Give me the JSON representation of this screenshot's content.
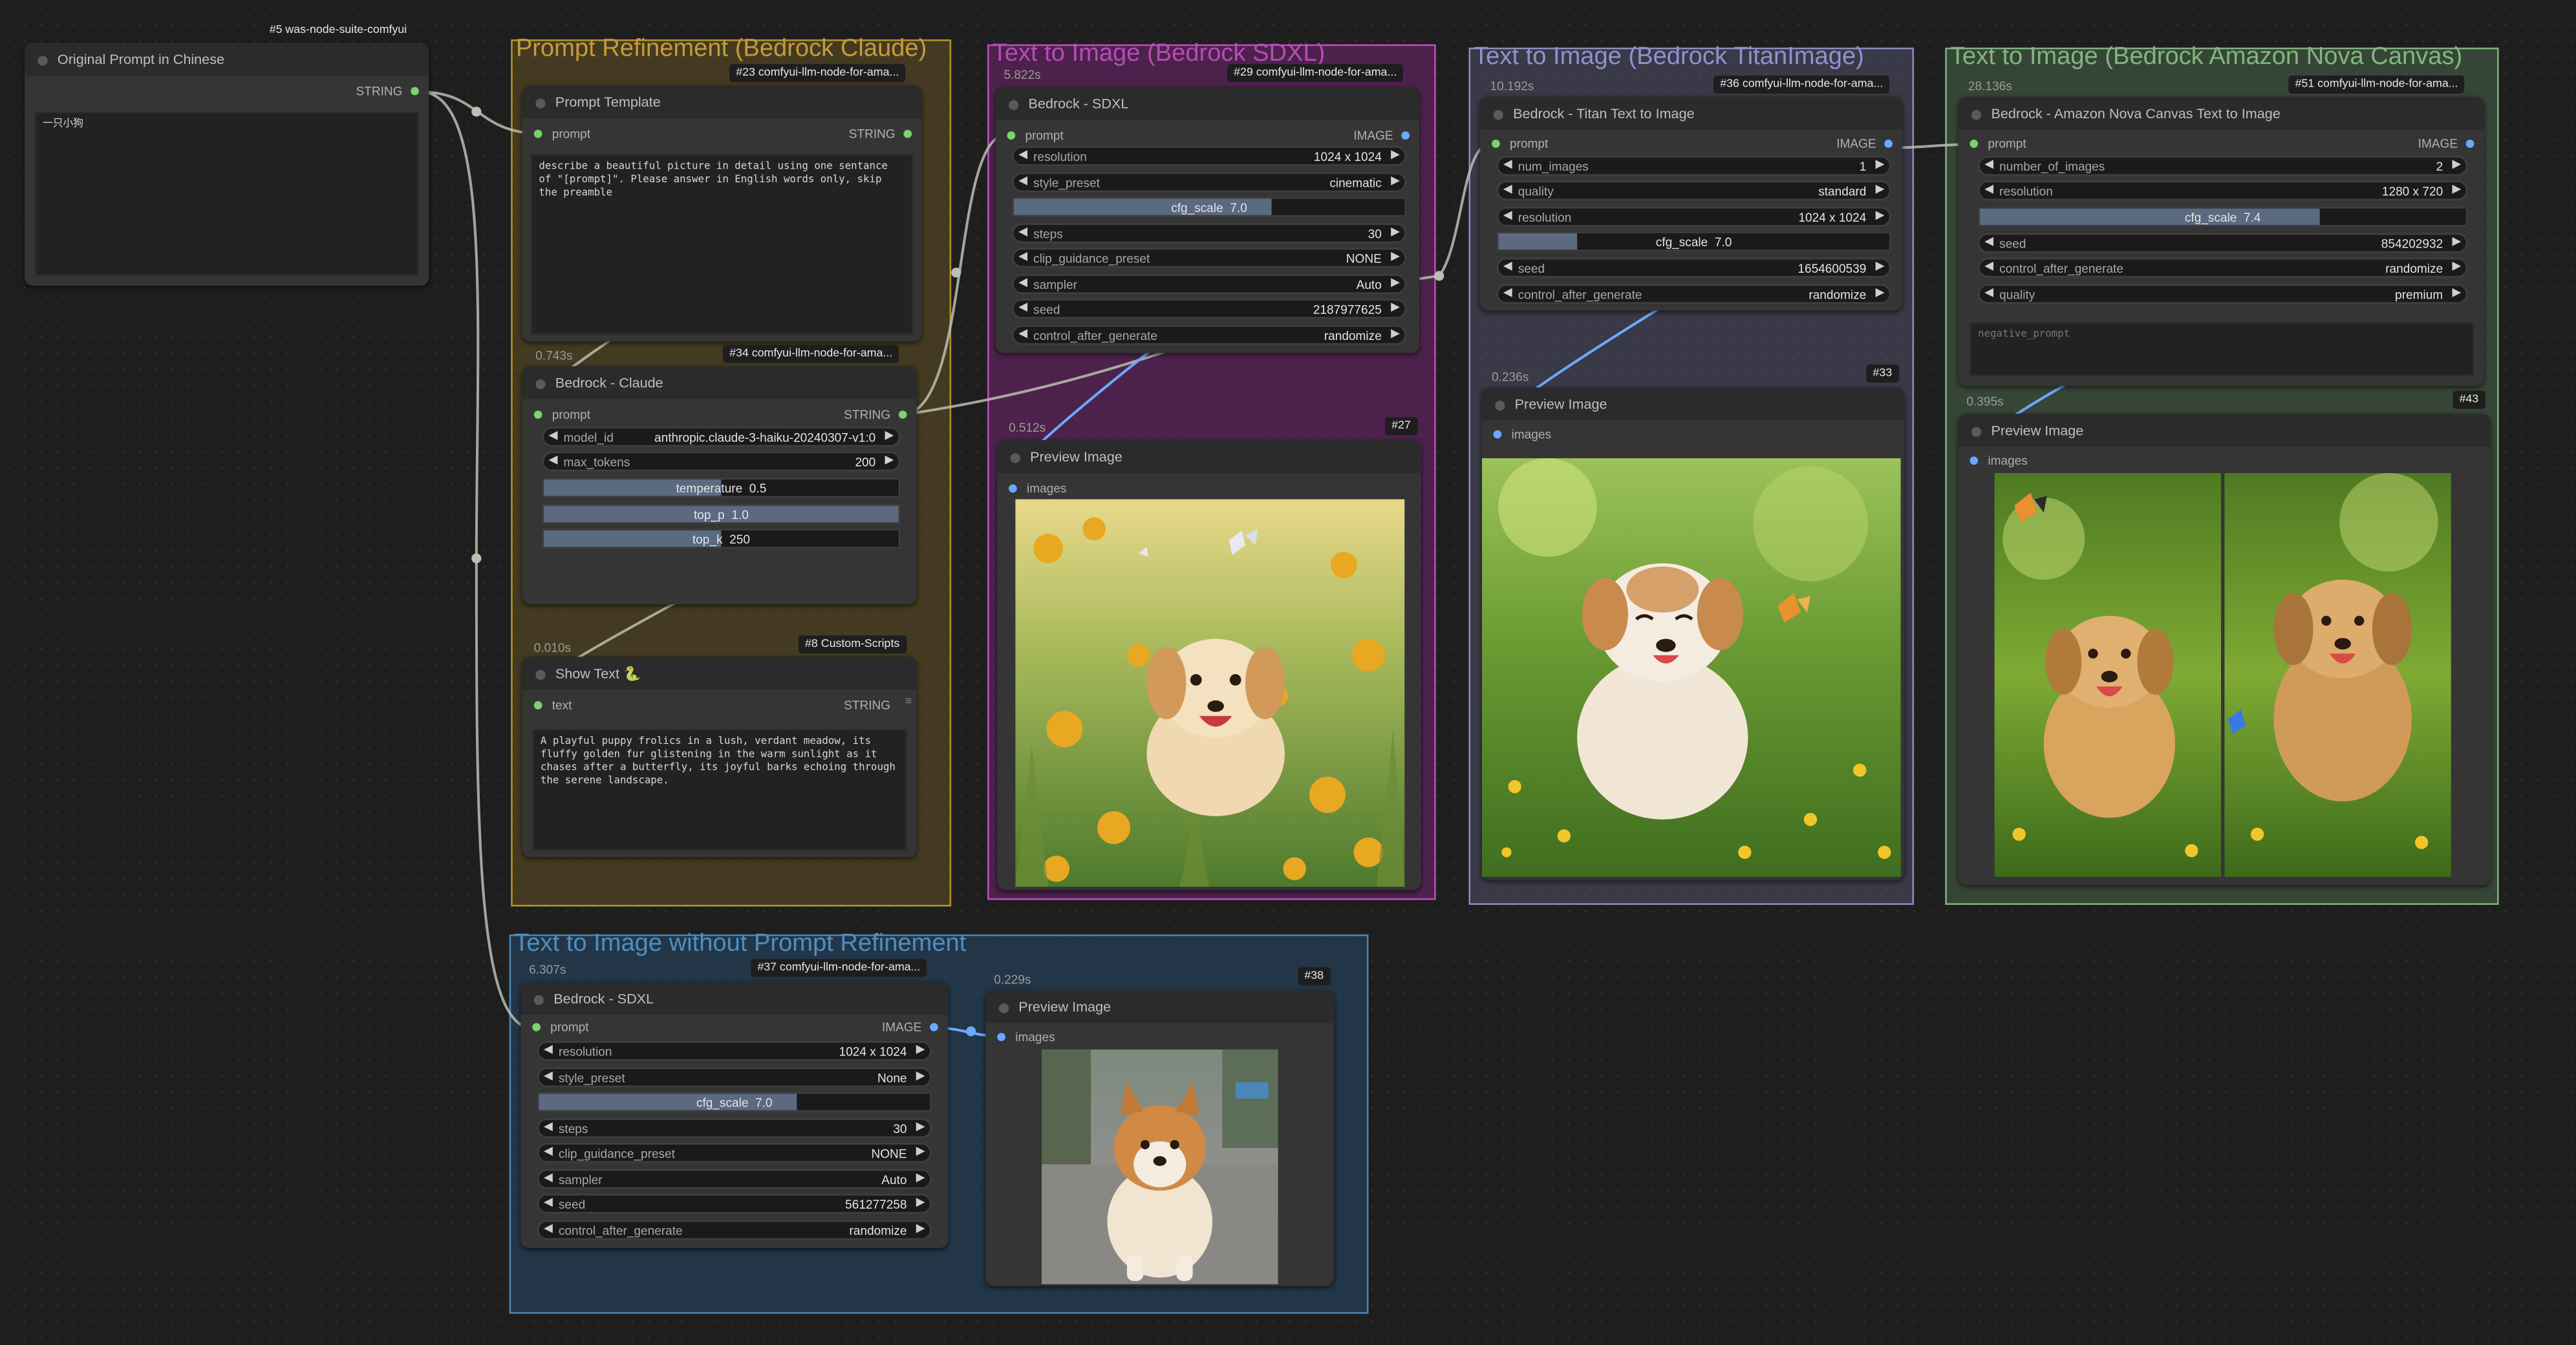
{
  "groups": {
    "prompt_refinement": {
      "title": "Prompt Refinement (Bedrock Claude)",
      "color": "#9a7b2c"
    },
    "sdxl": {
      "title": "Text to Image (Bedrock SDXL)",
      "color": "#a43da4"
    },
    "titan": {
      "title": "Text to Image (Bedrock TitanImage)",
      "color": "#8d8fc8"
    },
    "nova": {
      "title": "Text to Image (Bedrock Amazon Nova Canvas)",
      "color": "#7fb07e"
    },
    "no_refinement": {
      "title": "Text to Image without Prompt Refinement",
      "color": "#4f86b3"
    }
  },
  "nodes": {
    "original_prompt": {
      "badge": "#5 was-node-suite-comfyui",
      "title": "Original Prompt in Chinese",
      "out_label": "STRING",
      "text": "一只小狗"
    },
    "prompt_template": {
      "badge": "#23 comfyui-llm-node-for-ama...",
      "title": "Prompt Template",
      "in_label": "prompt",
      "out_label": "STRING",
      "text": "describe a beautiful picture in detail using one sentance of \"[prompt]\". Please answer in English words only, skip the preamble",
      "timing": "0.743s"
    },
    "claude": {
      "badge": "#34 comfyui-llm-node-for-ama...",
      "title": "Bedrock - Claude",
      "in_label": "prompt",
      "out_label": "STRING",
      "widgets": [
        {
          "label": "model_id",
          "value": "anthropic.claude-3-haiku-20240307-v1:0"
        },
        {
          "label": "max_tokens",
          "value": "200"
        }
      ],
      "sliders": [
        {
          "label": "temperature",
          "value": "0.5",
          "fraction": 0.5
        },
        {
          "label": "top_p",
          "value": "1.0",
          "fraction": 1.0
        },
        {
          "label": "top_k",
          "value": "250",
          "fraction": 0.5
        }
      ],
      "timing": "0.010s"
    },
    "show_text": {
      "badge": "#8 Custom-Scripts",
      "title": "Show Text 🐍",
      "in_label": "text",
      "out_label": "STRING",
      "text": "A playful puppy frolics in a lush, verdant meadow, its fluffy golden fur glistening in the warm sunlight as it chases after a butterfly, its joyful barks echoing through the serene landscape."
    },
    "sdxl": {
      "badge": "#29 comfyui-llm-node-for-ama...",
      "title": "Bedrock - SDXL",
      "timing": "5.822s",
      "in_label": "prompt",
      "out_label": "IMAGE",
      "widgets": [
        {
          "label": "resolution",
          "value": "1024 x 1024"
        },
        {
          "label": "style_preset",
          "value": "cinematic"
        }
      ],
      "slider": {
        "label": "cfg_scale",
        "value": "7.0",
        "fraction": 0.5
      },
      "widgets2": [
        {
          "label": "steps",
          "value": "30"
        },
        {
          "label": "clip_guidance_preset",
          "value": "NONE"
        },
        {
          "label": "sampler",
          "value": "Auto"
        },
        {
          "label": "seed",
          "value": "2187977625"
        },
        {
          "label": "control_after_generate",
          "value": "randomize"
        }
      ]
    },
    "preview27": {
      "badge": "#27",
      "title": "Preview Image",
      "in_label": "images",
      "timing": "0.512s"
    },
    "titan": {
      "badge": "#36 comfyui-llm-node-for-ama...",
      "title": "Bedrock - Titan Text to Image",
      "timing": "10.192s",
      "in_label": "prompt",
      "out_label": "IMAGE",
      "widgets": [
        {
          "label": "num_images",
          "value": "1"
        },
        {
          "label": "quality",
          "value": "standard"
        },
        {
          "label": "resolution",
          "value": "1024 x 1024"
        }
      ],
      "slider": {
        "label": "cfg_scale",
        "value": "7.0",
        "fraction": 0.2
      },
      "widgets2": [
        {
          "label": "seed",
          "value": "1654600539"
        },
        {
          "label": "control_after_generate",
          "value": "randomize"
        }
      ]
    },
    "preview33": {
      "badge": "#33",
      "title": "Preview Image",
      "in_label": "images",
      "timing": "0.236s"
    },
    "nova": {
      "badge": "#51 comfyui-llm-node-for-ama...",
      "title": "Bedrock - Amazon Nova Canvas Text to Image",
      "timing": "28.136s",
      "in_label": "prompt",
      "out_label": "IMAGE",
      "widgets": [
        {
          "label": "number_of_images",
          "value": "2"
        },
        {
          "label": "resolution",
          "value": "1280 x 720"
        }
      ],
      "slider": {
        "label": "cfg_scale",
        "value": "7.4",
        "fraction": 0.7
      },
      "widgets2": [
        {
          "label": "seed",
          "value": "854202932"
        },
        {
          "label": "control_after_generate",
          "value": "randomize"
        },
        {
          "label": "quality",
          "value": "premium"
        }
      ],
      "negative_placeholder": "negative_prompt"
    },
    "preview43": {
      "badge": "#43",
      "title": "Preview Image",
      "in_label": "images",
      "timing": "0.395s"
    },
    "sdxl2": {
      "badge": "#37 comfyui-llm-node-for-ama...",
      "title": "Bedrock - SDXL",
      "timing": "6.307s",
      "in_label": "prompt",
      "out_label": "IMAGE",
      "widgets": [
        {
          "label": "resolution",
          "value": "1024 x 1024"
        },
        {
          "label": "style_preset",
          "value": "None"
        }
      ],
      "slider": {
        "label": "cfg_scale",
        "value": "7.0",
        "fraction": 0.66
      },
      "widgets2": [
        {
          "label": "steps",
          "value": "30"
        },
        {
          "label": "clip_guidance_preset",
          "value": "NONE"
        },
        {
          "label": "sampler",
          "value": "Auto"
        },
        {
          "label": "seed",
          "value": "561277258"
        },
        {
          "label": "control_after_generate",
          "value": "randomize"
        }
      ]
    },
    "preview38": {
      "badge": "#38",
      "title": "Preview Image",
      "in_label": "images",
      "timing": "0.229s"
    }
  },
  "colors": {
    "string_slot": "#7bd36e",
    "image_slot": "#6aa9ff",
    "wire": "#b9c0b0",
    "image_wire": "#6aa9ff"
  }
}
